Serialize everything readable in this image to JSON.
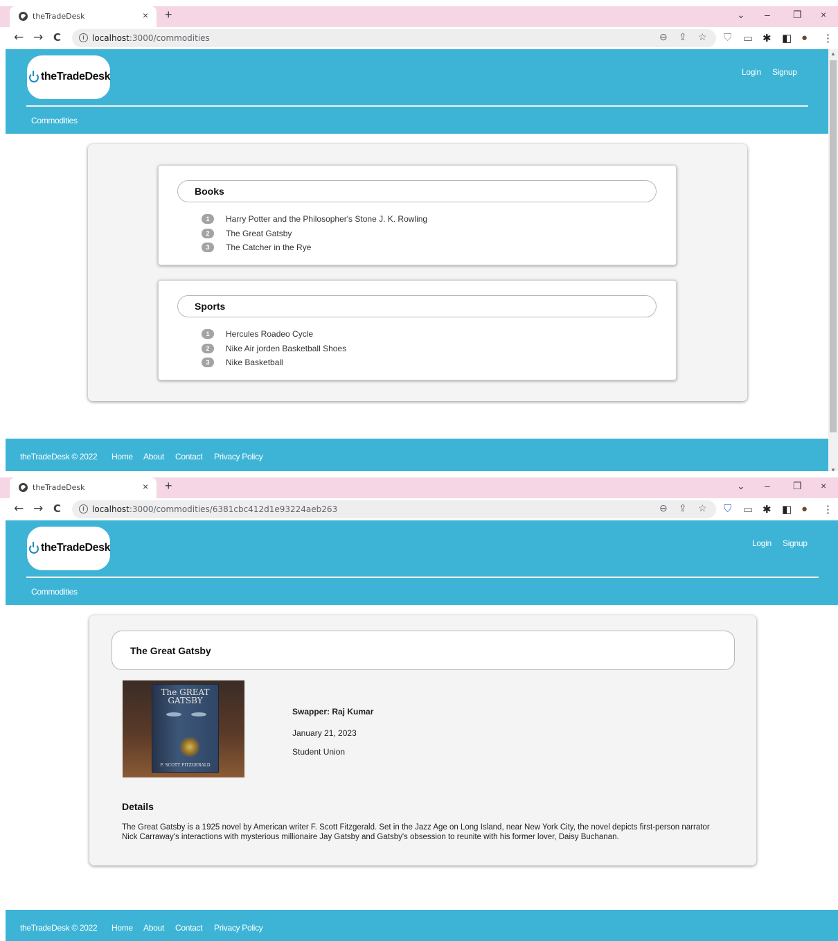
{
  "list_view": {
    "browser": {
      "tab_title": "theTradeDesk",
      "url_host": "localhost",
      "url_path": ":3000/commodities"
    },
    "header": {
      "logo_text": "theTradeDesk",
      "login": "Login",
      "signup": "Signup",
      "nav_commodities": "Commodities"
    },
    "categories": [
      {
        "title": "Books",
        "items": [
          {
            "num": "1",
            "label": "Harry Potter and the Philosopher's Stone J. K. Rowling"
          },
          {
            "num": "2",
            "label": "The Great Gatsby"
          },
          {
            "num": "3",
            "label": "The Catcher in the Rye"
          }
        ]
      },
      {
        "title": "Sports",
        "items": [
          {
            "num": "1",
            "label": "Hercules Roadeo Cycle"
          },
          {
            "num": "2",
            "label": "Nike Air jorden Basketball Shoes"
          },
          {
            "num": "3",
            "label": "Nike Basketball"
          }
        ]
      }
    ],
    "footer": {
      "copyright": "theTradeDesk © 2022",
      "home": "Home",
      "about": "About",
      "contact": "Contact",
      "privacy": "Privacy Policy"
    }
  },
  "detail_view": {
    "browser": {
      "tab_title": "theTradeDesk",
      "url_host": "localhost",
      "url_path": ":3000/commodities/6381cbc412d1e93224aeb263"
    },
    "header": {
      "logo_text": "theTradeDesk",
      "login": "Login",
      "signup": "Signup",
      "nav_commodities": "Commodities"
    },
    "item": {
      "title": "The Great Gatsby",
      "cover_line1": "The GREAT",
      "cover_line2": "GATSBY",
      "cover_author": "F. SCOTT FITZGERALD",
      "swapper": "Swapper: Raj Kumar",
      "date": "January 21, 2023",
      "location": "Student Union",
      "details_heading": "Details",
      "details_text": "The Great Gatsby is a 1925 novel by American writer F. Scott Fitzgerald. Set in the Jazz Age on Long Island, near New York City, the novel depicts first-person narrator Nick Carraway's interactions with mysterious millionaire Jay Gatsby and Gatsby's obsession to reunite with his former lover, Daisy Buchanan."
    },
    "footer": {
      "copyright": "theTradeDesk © 2022",
      "home": "Home",
      "about": "About",
      "contact": "Contact",
      "privacy": "Privacy Policy"
    }
  },
  "icons": {
    "back": "←",
    "forward": "→",
    "reload": "C",
    "close_tab": "×",
    "new_tab": "+",
    "minimize": "–",
    "restore": "❐",
    "close_window": "×",
    "chevron": "⌄",
    "zoom": "⊖",
    "share": "⇪",
    "star": "☆",
    "shield": "⛉",
    "cast": "▭",
    "puzzle": "✱",
    "sidepanel": "◧",
    "profile": "●",
    "menu": "⋮",
    "info": "i"
  },
  "colors": {
    "header_bg": "#3db4d6",
    "tabstrip_bg": "#f6d6e5",
    "card_bg": "#f4f4f4",
    "badge_bg": "#a3a3a3"
  }
}
